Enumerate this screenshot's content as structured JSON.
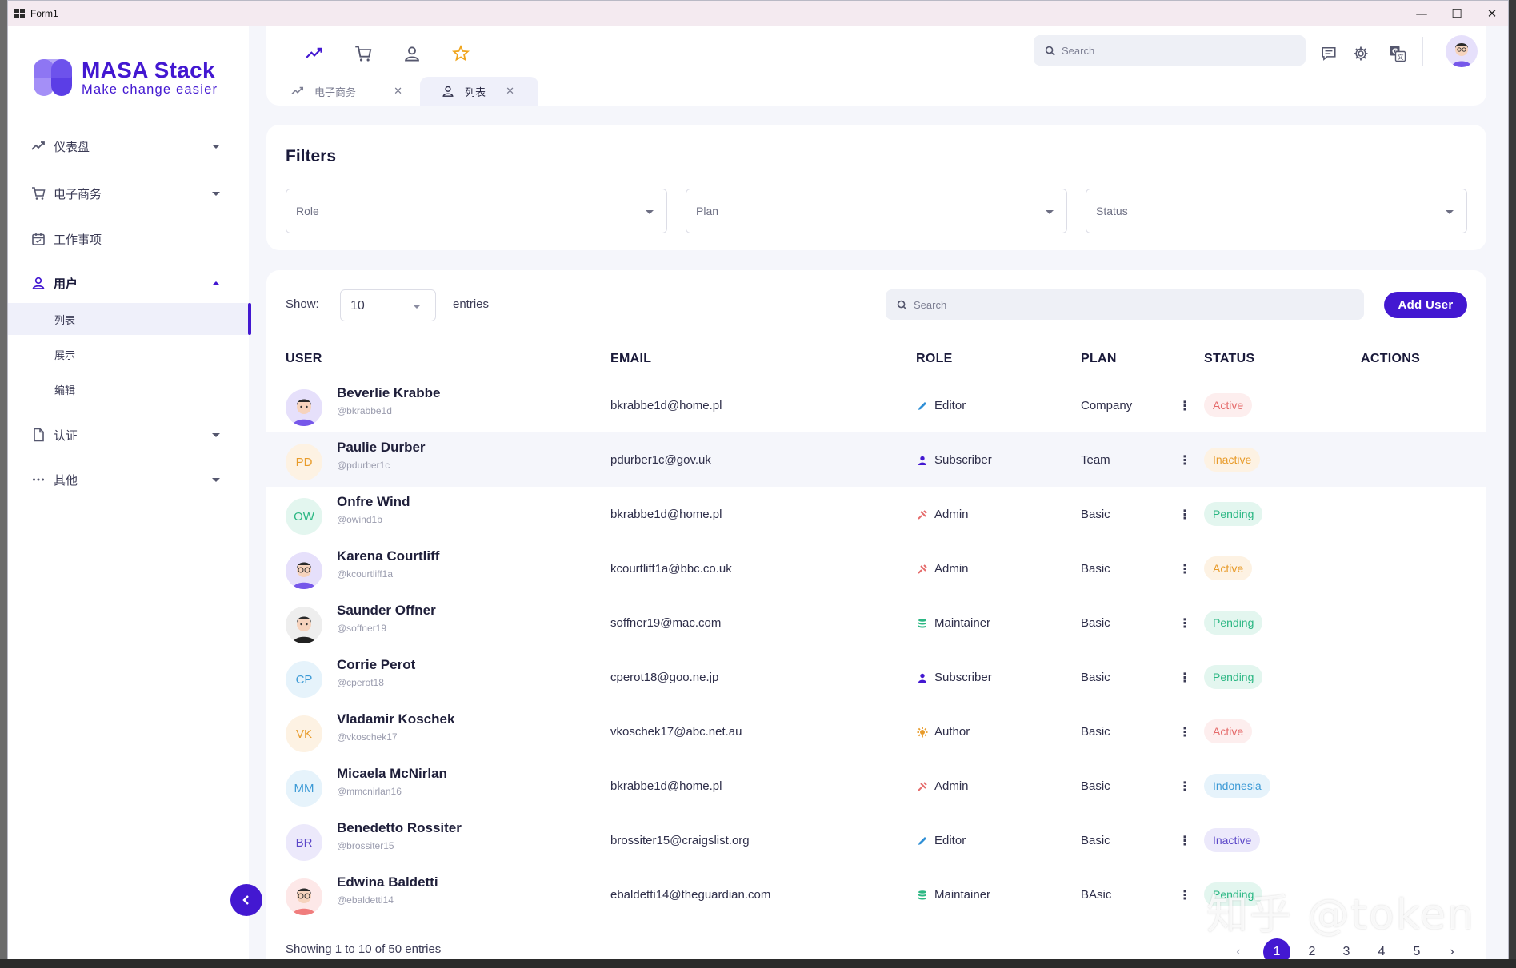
{
  "window": {
    "title": "Form1",
    "minimize": "—",
    "maximize": "☐",
    "close": "✕"
  },
  "sidebar": {
    "logo": {
      "title": "MASA Stack",
      "tagline": "Make change easier"
    },
    "items": [
      {
        "label": "仪表盘",
        "icon": "trend-icon"
      },
      {
        "label": "电子商务",
        "icon": "cart-icon"
      },
      {
        "label": "工作事项",
        "icon": "calendar-icon"
      },
      {
        "label": "用户",
        "icon": "user-icon"
      },
      {
        "label": "认证",
        "icon": "document-icon"
      },
      {
        "label": "其他",
        "icon": "more-icon"
      }
    ],
    "sub_items": [
      "列表",
      "展示",
      "编辑"
    ]
  },
  "header": {
    "search_placeholder": "Search",
    "tabs": [
      {
        "label": "电子商务",
        "icon": "trend-icon",
        "close": "✕"
      },
      {
        "label": "列表",
        "icon": "user-icon",
        "close": "✕"
      }
    ]
  },
  "filters": {
    "title": "Filters",
    "role": "Role",
    "plan": "Plan",
    "status": "Status"
  },
  "table": {
    "show_label": "Show:",
    "show_value": "10",
    "entries_label": "entries",
    "search_placeholder": "Search",
    "add_user": "Add User",
    "columns": [
      "USER",
      "EMAIL",
      "ROLE",
      "PLAN",
      "STATUS",
      "ACTIONS"
    ],
    "rows": [
      {
        "name": "Beverlie Krabbe",
        "handle": "@bkrabbe1d",
        "initials": "",
        "email": "bkrabbe1d@home.pl",
        "role": "Editor",
        "plan": "Company",
        "status": "Active"
      },
      {
        "name": "Paulie Durber",
        "handle": "@pdurber1c",
        "initials": "PD",
        "email": "pdurber1c@gov.uk",
        "role": "Subscriber",
        "plan": "Team",
        "status": "Inactive"
      },
      {
        "name": "Onfre Wind",
        "handle": "@owind1b",
        "initials": "OW",
        "email": "bkrabbe1d@home.pl",
        "role": "Admin",
        "plan": "Basic",
        "status": "Pending"
      },
      {
        "name": "Karena Courtliff",
        "handle": "@kcourtliff1a",
        "initials": "",
        "email": "kcourtliff1a@bbc.co.uk",
        "role": "Admin",
        "plan": "Basic",
        "status": "Active"
      },
      {
        "name": "Saunder Offner",
        "handle": "@soffner19",
        "initials": "",
        "email": "soffner19@mac.com",
        "role": "Maintainer",
        "plan": "Basic",
        "status": "Pending"
      },
      {
        "name": "Corrie Perot",
        "handle": "@cperot18",
        "initials": "CP",
        "email": "cperot18@goo.ne.jp",
        "role": "Subscriber",
        "plan": "Basic",
        "status": "Pending"
      },
      {
        "name": "Vladamir Koschek",
        "handle": "@vkoschek17",
        "initials": "VK",
        "email": "vkoschek17@abc.net.au",
        "role": "Author",
        "plan": "Basic",
        "status": "Active"
      },
      {
        "name": "Micaela McNirlan",
        "handle": "@mmcnirlan16",
        "initials": "MM",
        "email": "bkrabbe1d@home.pl",
        "role": "Admin",
        "plan": "Basic",
        "status": "Indonesia"
      },
      {
        "name": "Benedetto Rossiter",
        "handle": "@brossiter15",
        "initials": "BR",
        "email": "brossiter15@craigslist.org",
        "role": "Editor",
        "plan": "Basic",
        "status": "Inactive"
      },
      {
        "name": "Edwina Baldetti",
        "handle": "@ebaldetti14",
        "initials": "",
        "email": "ebaldetti14@theguardian.com",
        "role": "Maintainer",
        "plan": "BAsic",
        "status": "Pending"
      }
    ],
    "actions_glyph": "⋮",
    "footer": "Showing 1 to 10 of 50 entries",
    "pages": [
      "1",
      "2",
      "3",
      "4",
      "5"
    ],
    "prev": "‹",
    "next": "›"
  },
  "watermark": "知乎 @token",
  "colors": {
    "accent": "#4318d1"
  }
}
